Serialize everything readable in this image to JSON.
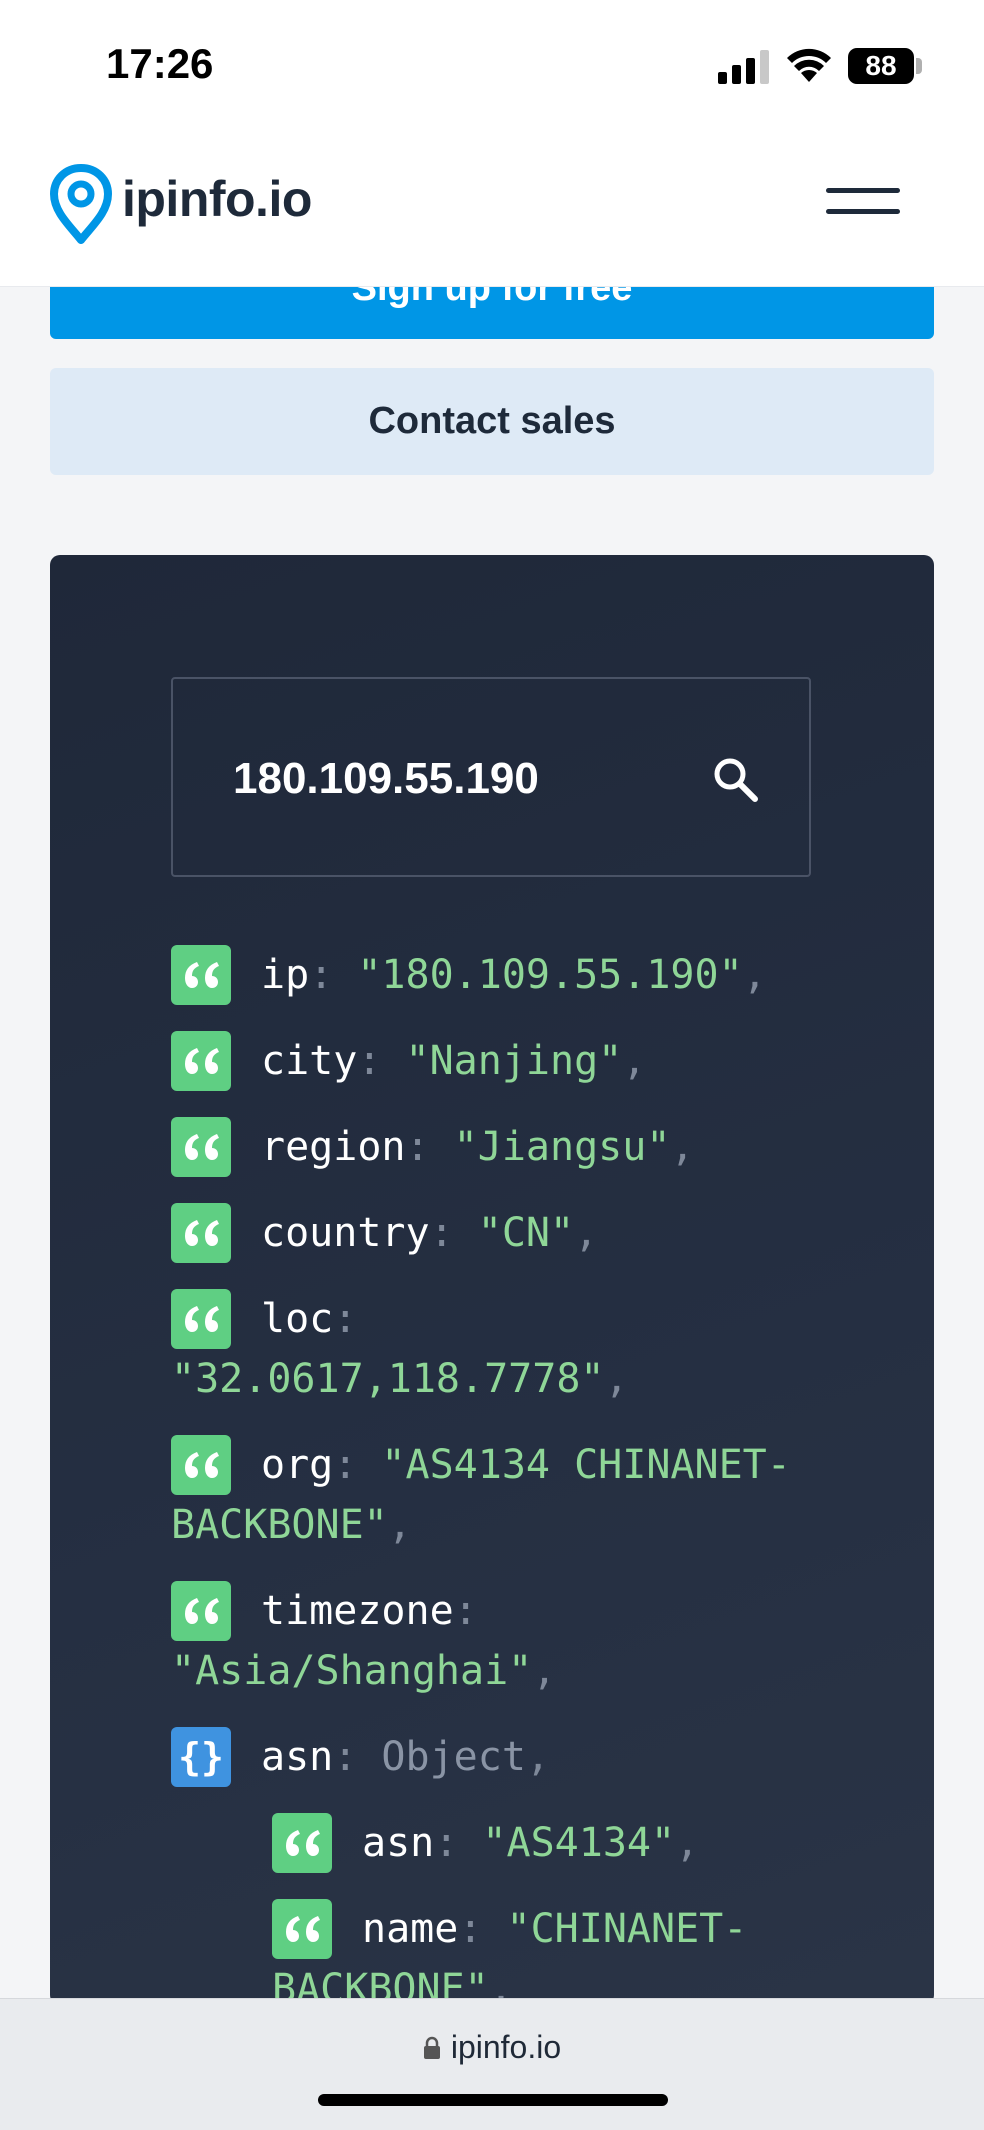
{
  "status_bar": {
    "time": "17:26",
    "battery": "88"
  },
  "header": {
    "logo_text": "ipinfo.io",
    "brand_color": "#0096e6"
  },
  "buttons": {
    "signup_label": "Sign up for free",
    "contact_label": "Contact sales"
  },
  "search": {
    "value": "180.109.55.190"
  },
  "json_fields": [
    {
      "key": "ip",
      "value": "\"180.109.55.190\"",
      "suffix": ","
    },
    {
      "key": "city",
      "value": "\"Nanjing\"",
      "suffix": ","
    },
    {
      "key": "region",
      "value": "\"Jiangsu\"",
      "suffix": ","
    },
    {
      "key": "country",
      "value": "\"CN\"",
      "suffix": ","
    },
    {
      "key": "loc",
      "value": "\"32.0617,118.7778\"",
      "suffix": ","
    },
    {
      "key": "org",
      "value_line1": "\"AS4134 CHINANET-",
      "value_line2": "BACKBONE\"",
      "suffix": ","
    },
    {
      "key": "timezone",
      "value": "\"Asia/Shanghai\"",
      "suffix": ","
    },
    {
      "key": "asn",
      "value": "Object",
      "suffix": ","
    },
    {
      "key": "asn",
      "value": "\"AS4134\"",
      "suffix": ","
    },
    {
      "key": "name",
      "value_line1": "\"CHINANET-",
      "value_line2": "BACKBONE\"",
      "suffix": ","
    }
  ],
  "browser": {
    "url": "ipinfo.io"
  }
}
